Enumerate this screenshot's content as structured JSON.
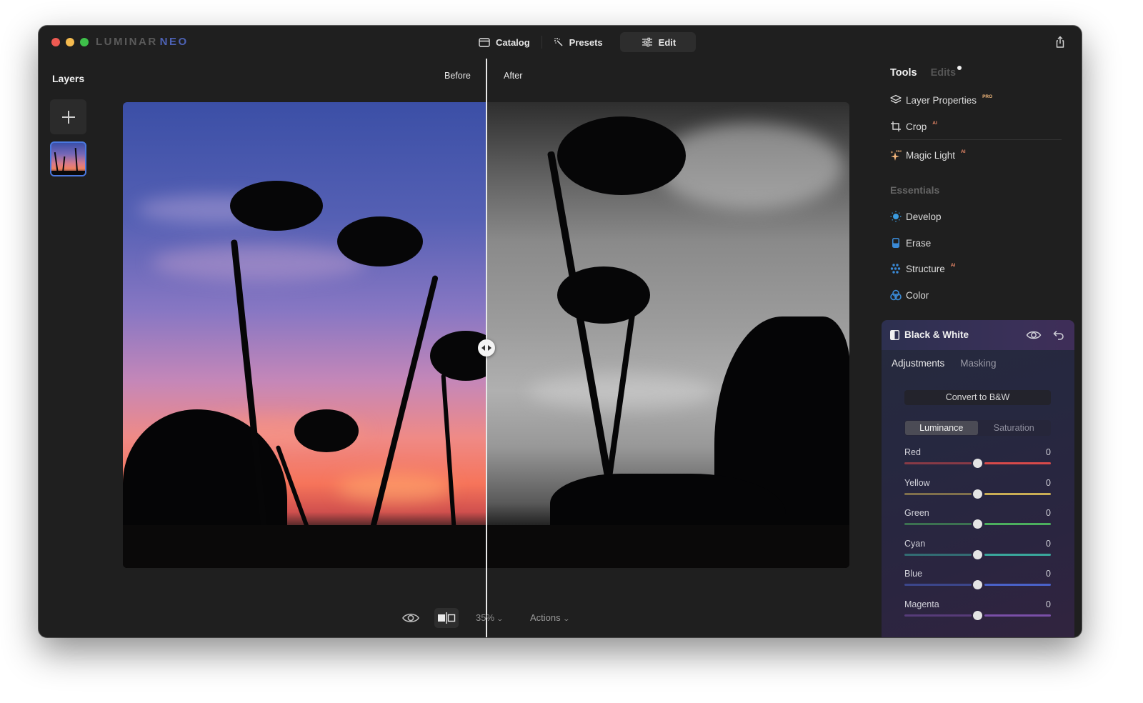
{
  "app": {
    "logo_part1": "LUMINAR",
    "logo_part2": "NEO",
    "accent_color": "#4a78e0"
  },
  "modes": [
    {
      "label": "Catalog",
      "icon": "folder-icon",
      "active": false
    },
    {
      "label": "Presets",
      "icon": "magic-wand-icon",
      "active": false
    },
    {
      "label": "Edit",
      "icon": "sliders-icon",
      "active": true
    }
  ],
  "layers": {
    "title": "Layers",
    "add_icon": "plus-icon"
  },
  "canvas": {
    "before_label": "Before",
    "after_label": "After",
    "split_position": 0.5
  },
  "bottom_toolbar": {
    "zoom_level": "35%",
    "actions_label": "Actions"
  },
  "panel": {
    "tabs": {
      "tools": "Tools",
      "edits": "Edits"
    },
    "tools": [
      {
        "label": "Layer Properties",
        "badge": "PRO",
        "icon": "layers-icon"
      },
      {
        "label": "Crop",
        "badge": "AI",
        "icon": "crop-icon"
      },
      {
        "label": "Magic Light",
        "badge": "AI",
        "icon": "sparkles-icon",
        "icon_badge": "PRO"
      }
    ],
    "essentials_title": "Essentials",
    "essentials": [
      {
        "label": "Develop",
        "badge": "",
        "icon": "sun-icon"
      },
      {
        "label": "Erase",
        "badge": "",
        "icon": "eraser-icon"
      },
      {
        "label": "Structure",
        "badge": "AI",
        "icon": "dots-grid-icon"
      },
      {
        "label": "Color",
        "badge": "",
        "icon": "color-circles-icon"
      }
    ]
  },
  "bw_panel": {
    "title": "Black & White",
    "subtabs": [
      "Adjustments",
      "Masking"
    ],
    "active_subtab": "Adjustments",
    "convert_label": "Convert to B&W",
    "segments": [
      "Luminance",
      "Saturation"
    ],
    "active_segment": "Luminance",
    "sliders": [
      {
        "label": "Red",
        "value": "0",
        "min": -100,
        "max": 100,
        "position": 0,
        "color": "#d84a4a"
      },
      {
        "label": "Yellow",
        "value": "0",
        "min": -100,
        "max": 100,
        "position": 0,
        "color": "#c9ad55"
      },
      {
        "label": "Green",
        "value": "0",
        "min": -100,
        "max": 100,
        "position": 0,
        "color": "#4caf5e"
      },
      {
        "label": "Cyan",
        "value": "0",
        "min": -100,
        "max": 100,
        "position": 0,
        "color": "#3aa79c"
      },
      {
        "label": "Blue",
        "value": "0",
        "min": -100,
        "max": 100,
        "position": 0,
        "color": "#4a62c9"
      },
      {
        "label": "Magenta",
        "value": "0",
        "min": -100,
        "max": 100,
        "position": 0,
        "color": "#7a4fa8"
      }
    ]
  }
}
